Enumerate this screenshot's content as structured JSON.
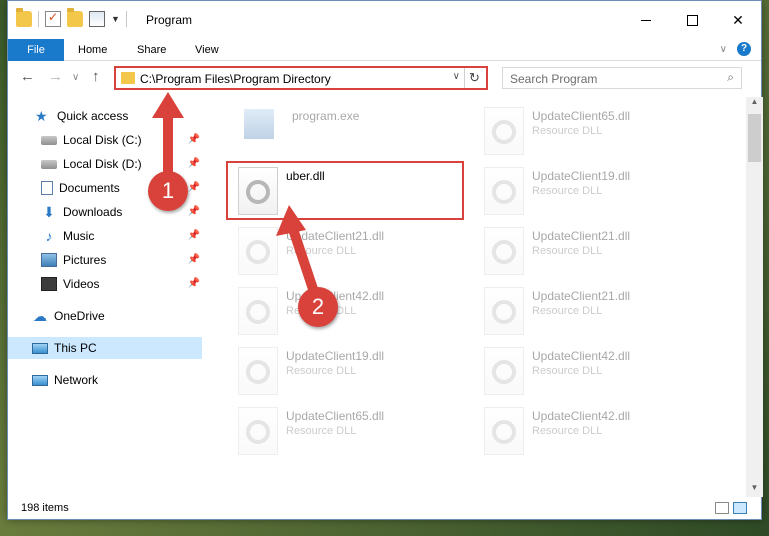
{
  "window": {
    "title": "Program",
    "controls": {
      "close_glyph": "✕"
    }
  },
  "ribbon": {
    "tabs": [
      "File",
      "Home",
      "Share",
      "View"
    ]
  },
  "navbar": {
    "back_glyph": "←",
    "forward_glyph": "→",
    "up_glyph": "↑",
    "address": "C:\\Program Files\\Program Directory",
    "search_placeholder": "Search Program"
  },
  "sidebar": {
    "items": [
      {
        "label": "Quick access",
        "icon": "star-icon",
        "pinned": false
      },
      {
        "label": "Local Disk (C:)",
        "icon": "disk-icon",
        "pinned": true
      },
      {
        "label": "Local Disk (D:)",
        "icon": "disk-icon",
        "pinned": true
      },
      {
        "label": "Documents",
        "icon": "documents-icon",
        "pinned": true
      },
      {
        "label": "Downloads",
        "icon": "downloads-icon",
        "pinned": true
      },
      {
        "label": "Music",
        "icon": "music-icon",
        "pinned": true
      },
      {
        "label": "Pictures",
        "icon": "pictures-icon",
        "pinned": true
      },
      {
        "label": "Videos",
        "icon": "videos-icon",
        "pinned": true
      },
      {
        "label": "OneDrive",
        "icon": "onedrive-icon",
        "pinned": false
      },
      {
        "label": "This PC",
        "icon": "this-pc-icon",
        "pinned": false,
        "selected": true
      },
      {
        "label": "Network",
        "icon": "network-icon",
        "pinned": false
      }
    ]
  },
  "files": {
    "left": [
      {
        "name": "program.exe",
        "type": "",
        "kind": "exe",
        "faded": true
      },
      {
        "name": "uber.dll",
        "type": "",
        "kind": "dll",
        "faded": false,
        "highlighted": true
      },
      {
        "name": "UpdateClient21.dll",
        "type": "Resource DLL",
        "kind": "dll",
        "faded": true
      },
      {
        "name": "UpdateClient42.dll",
        "type": "Resource DLL",
        "kind": "dll",
        "faded": true
      },
      {
        "name": "UpdateClient19.dll",
        "type": "Resource DLL",
        "kind": "dll",
        "faded": true
      },
      {
        "name": "UpdateClient65.dll",
        "type": "Resource DLL",
        "kind": "dll",
        "faded": true
      }
    ],
    "right": [
      {
        "name": "UpdateClient65.dll",
        "type": "Resource DLL",
        "kind": "dll",
        "faded": true
      },
      {
        "name": "UpdateClient19.dll",
        "type": "Resource DLL",
        "kind": "dll",
        "faded": true
      },
      {
        "name": "UpdateClient21.dll",
        "type": "Resource DLL",
        "kind": "dll",
        "faded": true
      },
      {
        "name": "UpdateClient21.dll",
        "type": "Resource DLL",
        "kind": "dll",
        "faded": true
      },
      {
        "name": "UpdateClient42.dll",
        "type": "Resource DLL",
        "kind": "dll",
        "faded": true
      },
      {
        "name": "UpdateClient42.dll",
        "type": "Resource DLL",
        "kind": "dll",
        "faded": true
      }
    ]
  },
  "status": {
    "item_count": "198 items"
  },
  "annotations": {
    "step1": "1",
    "step2": "2",
    "color": "#d9423a"
  }
}
